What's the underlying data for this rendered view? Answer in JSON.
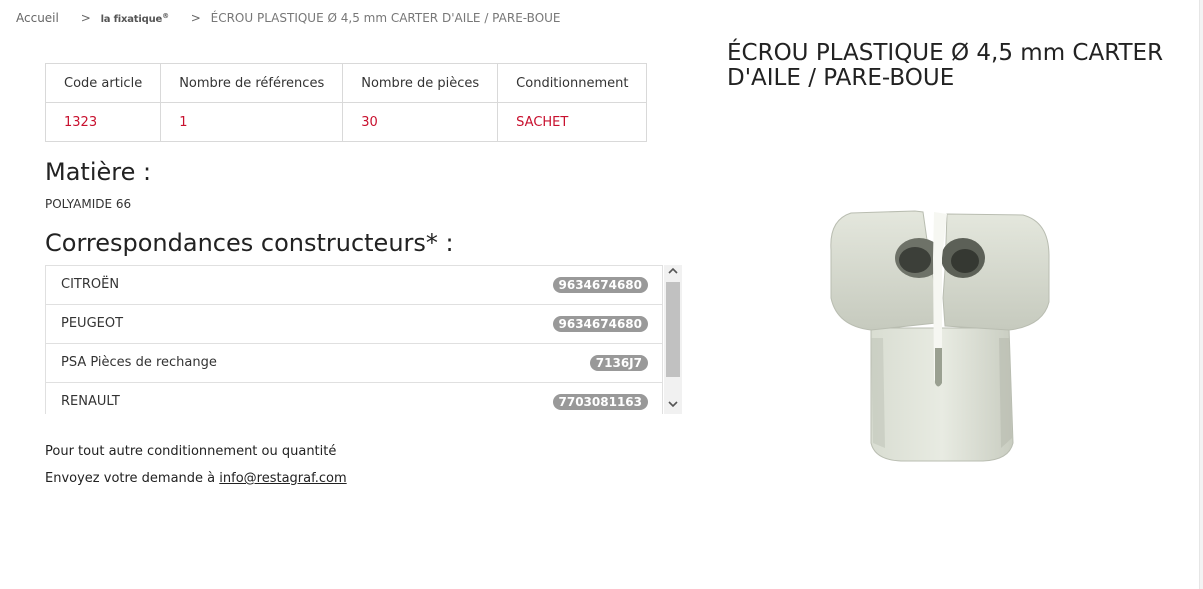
{
  "breadcrumb": {
    "home": "Accueil",
    "separator": ">",
    "brand": "la fixatique",
    "brand_mark": "®",
    "current": "ÉCROU PLASTIQUE Ø 4,5 mm CARTER D'AILE / PARE-BOUE"
  },
  "product": {
    "title": "ÉCROU PLASTIQUE Ø 4,5 mm CARTER D'AILE / PARE-BOUE",
    "image_icon": "plastic-nut-image"
  },
  "info_table": {
    "headers": [
      "Code article",
      "Nombre de références",
      "Nombre de pièces",
      "Conditionnement"
    ],
    "values": [
      "1323",
      "1",
      "30",
      "SACHET"
    ]
  },
  "matiere": {
    "heading": "Matière :",
    "value": "POLYAMIDE 66"
  },
  "correspondances": {
    "heading": "Correspondances constructeurs* :",
    "items": [
      {
        "brand": "CITROËN",
        "reference": "9634674680"
      },
      {
        "brand": "PEUGEOT",
        "reference": "9634674680"
      },
      {
        "brand": "PSA Pièces de rechange",
        "reference": "7136J7"
      },
      {
        "brand": "RENAULT",
        "reference": "7703081163"
      }
    ]
  },
  "contact": {
    "line1": "Pour tout autre conditionnement ou quantité",
    "line2_prefix": "Envoyez votre demande à ",
    "email": "info@restagraf.com"
  },
  "colors": {
    "accent_red": "#c8102e",
    "badge_grey": "#999999"
  }
}
